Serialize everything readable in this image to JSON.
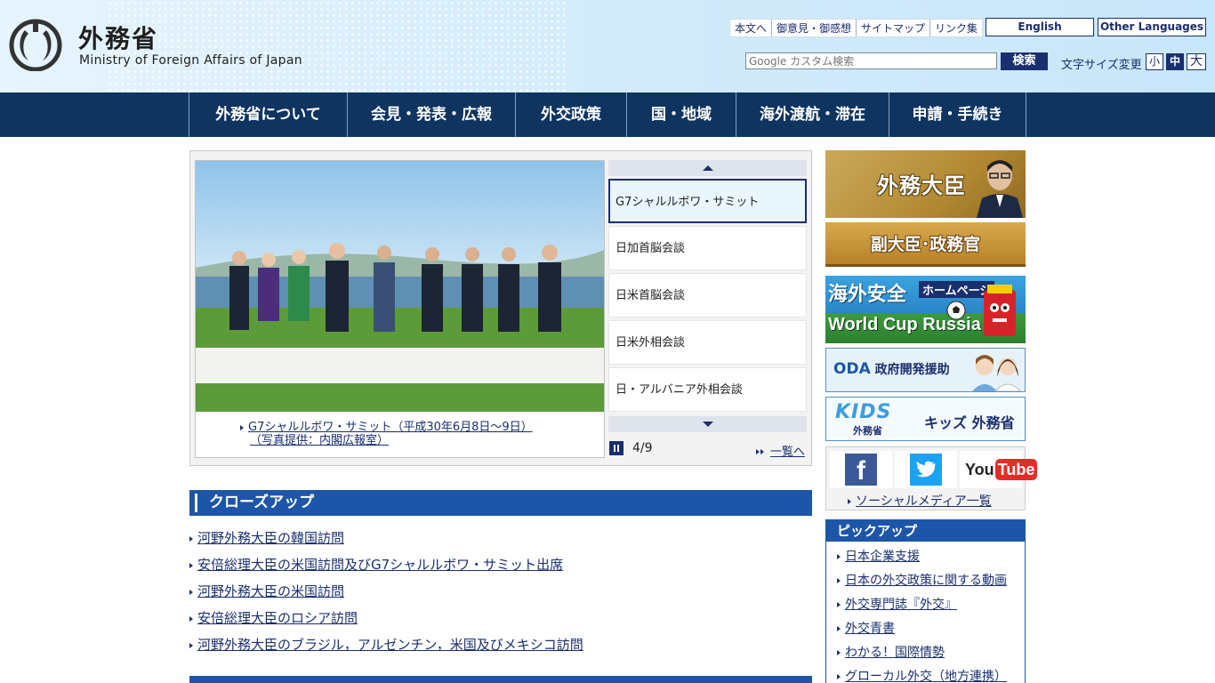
{
  "header": {
    "logo_title": "外務省",
    "logo_subtitle": "Ministry of Foreign Affairs of Japan",
    "utility_links": [
      "本文へ",
      "御意見・御感想",
      "サイトマップ",
      "リンク集"
    ],
    "lang_english": "English",
    "lang_other": "Other Languages",
    "search_placeholder": "Google カスタム検索",
    "search_button": "検索",
    "font_size_label": "文字サイズ変更",
    "font_size_small": "小",
    "font_size_medium": "中",
    "font_size_large": "大"
  },
  "nav": {
    "items": [
      "外務省について",
      "会見・発表・広報",
      "外交政策",
      "国・地域",
      "海外渡航・滞在",
      "申請・手続き"
    ]
  },
  "carousel": {
    "photo_caption_line1": "G7シャルルボワ・サミット（平成30年6月8日～9日）",
    "photo_caption_line2": "（写真提供：内閣広報室）",
    "items": [
      "G7シャルルボワ・サミット",
      "日加首脳会談",
      "日米首脳会談",
      "日米外相会談",
      "日・アルバニア外相会談"
    ],
    "active_index": 0,
    "counter": "4/9",
    "list_link": "一覧へ"
  },
  "closeup": {
    "title": "クローズアップ",
    "items": [
      "河野外務大臣の韓国訪問",
      "安倍総理大臣の米国訪問及びG7シャルルボワ・サミット出席",
      "河野外務大臣の米国訪問",
      "安倍総理大臣のロシア訪問",
      "河野外務大臣のブラジル，アルゼンチン，米国及びメキシコ訪問"
    ]
  },
  "banners": {
    "minister": "外務大臣",
    "vice_minister": "副大臣･政務官",
    "safety_title": "海外安全",
    "safety_tag": "ホームページ",
    "safety_event": "World Cup Russia",
    "oda_abbr": "ODA",
    "oda_label": "政府開発援助",
    "kids_logo": "KIDS",
    "kids_sub": "外務省",
    "kids_label": "キッズ 外務省"
  },
  "social": {
    "facebook": "f",
    "youtube_you": "You",
    "youtube_tube": "Tube",
    "list_link": "ソーシャルメディア一覧"
  },
  "pickup": {
    "title": "ピックアップ",
    "items": [
      "日本企業支援",
      "日本の外交政策に関する動画",
      "外交専門誌『外交』",
      "外交青書",
      "わかる！国際情勢",
      "グローカル外交（地方連携）"
    ]
  },
  "colors": {
    "navy": "#0f3460",
    "accent_blue": "#1d56a8",
    "link": "#1a2f6e"
  }
}
